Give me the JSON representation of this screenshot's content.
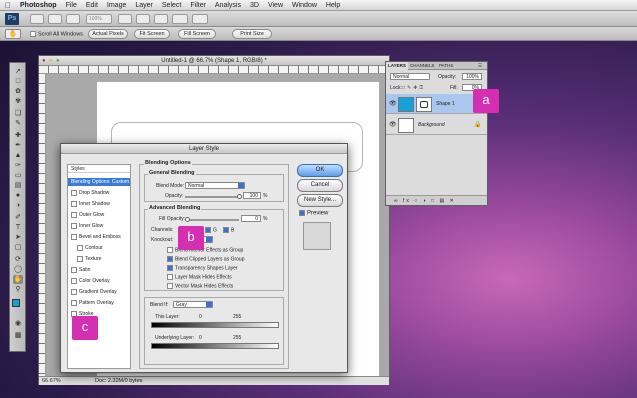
{
  "menubar": {
    "apple": "",
    "items": [
      "Photoshop",
      "File",
      "Edit",
      "Image",
      "Layer",
      "Select",
      "Filter",
      "Analysis",
      "3D",
      "View",
      "Window",
      "Help"
    ]
  },
  "appbar": {
    "logo": "Ps",
    "zoom_value": "100%"
  },
  "options": {
    "scroll_all_windows": "Scroll All Windows",
    "buttons": [
      "Actual Pixels",
      "Fit Screen",
      "Fill Screen",
      "Print Size"
    ]
  },
  "document": {
    "title": "Untitled-1 @ 66.7% (Shape 1, RGB/8) *",
    "zoom": "66.67%",
    "doc_info": "Doc: 2.32M/0 bytes"
  },
  "dialog": {
    "title": "Layer Style",
    "styles_header": "Styles",
    "blending_custom": "Blending Options: Custom",
    "effects": [
      "Drop Shadow",
      "Inner Shadow",
      "Outer Glow",
      "Inner Glow",
      "Bevel and Emboss",
      "Contour",
      "Texture",
      "Satin",
      "Color Overlay",
      "Gradient Overlay",
      "Pattern Overlay",
      "Stroke"
    ],
    "blending_options": "Blending Options",
    "general_blending": "General Blending",
    "blend_mode_label": "Blend Mode:",
    "blend_mode_value": "Normal",
    "opacity_label": "Opacity:",
    "opacity_value": "100",
    "percent": "%",
    "advanced_blending": "Advanced Blending",
    "fill_opacity_label": "Fill Opacity:",
    "fill_opacity_value": "0",
    "fill_opacity_level": 0,
    "channels_label": "Channels:",
    "channel_g": "G",
    "channel_b": "B",
    "knockout_label": "Knockout:",
    "adv_checks": [
      "Blend Interior Effects as Group",
      "Blend Clipped Layers as Group",
      "Transparency Shapes Layer",
      "Layer Mask Hides Effects",
      "Vector Mask Hides Effects"
    ],
    "blend_if_label": "Blend If:",
    "blend_if_value": "Gray",
    "this_layer": "This Layer:",
    "underlying_layer": "Underlying Layer:",
    "range_low": "0",
    "range_high": "255",
    "ok": "OK",
    "cancel": "Cancel",
    "new_style": "New Style...",
    "preview": "Preview"
  },
  "layers_panel": {
    "tabs": [
      "LAYERS",
      "CHANNELS",
      "PATHS"
    ],
    "mode": "Normal",
    "opacity_label": "Opacity:",
    "opacity_value": "100%",
    "lock_label": "Lock:",
    "fill_label": "Fill:",
    "fill_value": "0%",
    "layers": [
      {
        "name": "Shape 1",
        "thumb_color": "#1aa0d8"
      },
      {
        "name": "Background",
        "thumb_color": "#ffffff"
      }
    ],
    "bottom_icons": "∞  fx  ○  ◑  □  ▤  ✕"
  },
  "callouts": {
    "a": "a",
    "b": "b",
    "c": "c"
  },
  "colors": {
    "accent": "#d32fb0",
    "selection": "#3b7bd6",
    "shape_thumb": "#1aa0d8"
  }
}
